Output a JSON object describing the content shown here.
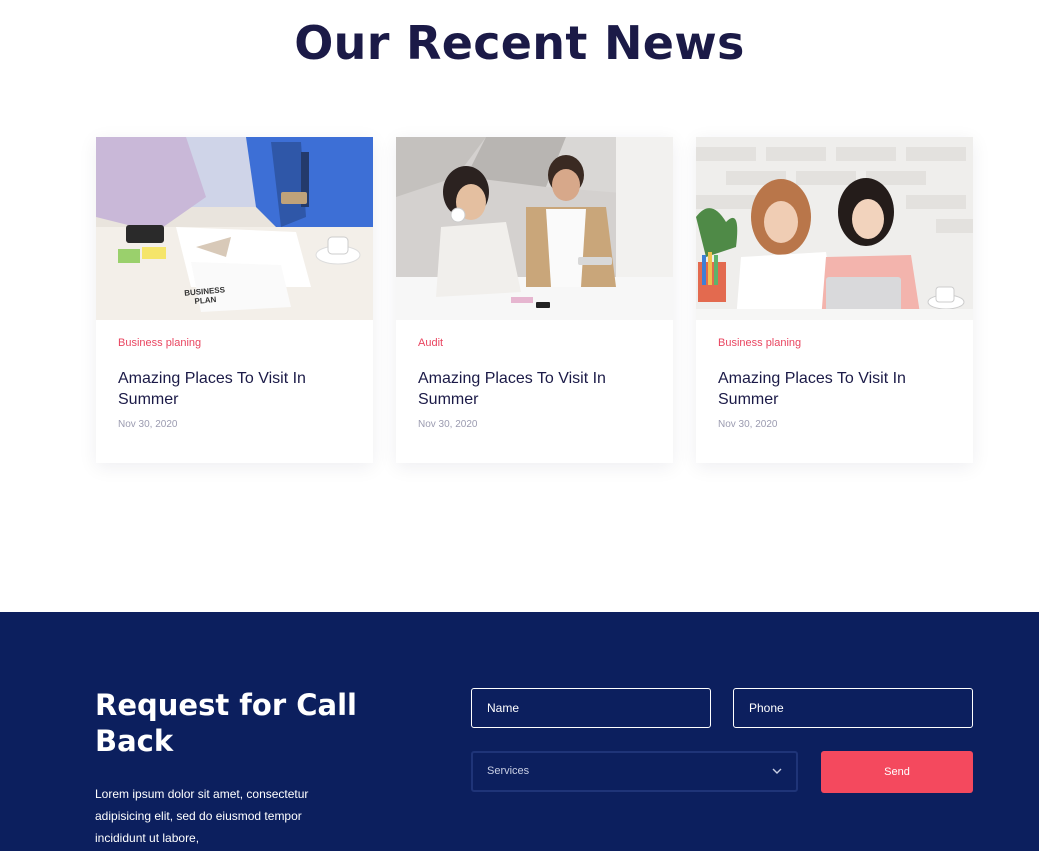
{
  "news": {
    "heading": "Our Recent News",
    "cards": [
      {
        "tag": "Business planing",
        "title": "Amazing Places To Visit In Summer",
        "date": "Nov 30, 2020",
        "image": "business-plan-meeting-photo"
      },
      {
        "tag": "Audit",
        "title": "Amazing Places To Visit In Summer",
        "date": "Nov 30, 2020",
        "image": "colleagues-at-desk-photo"
      },
      {
        "tag": "Business planing",
        "title": "Amazing Places To Visit In Summer",
        "date": "Nov 30, 2020",
        "image": "women-at-laptop-photo"
      }
    ],
    "image_text": "BUSINESS PLAN"
  },
  "callback": {
    "title": "Request for Call Back",
    "description": "Lorem ipsum dolor sit amet, consectetur adipisicing elit, sed do eiusmod tempor incididunt ut labore,",
    "name_placeholder": "Name",
    "phone_placeholder": "Phone",
    "services_value": "Services",
    "send_label": "Send"
  },
  "colors": {
    "accent": "#e94560",
    "navy": "#0c1f5e",
    "heading": "#1b1a47",
    "button": "#f4495e"
  },
  "icons": {
    "select_arrow": "chevron-down-icon"
  }
}
